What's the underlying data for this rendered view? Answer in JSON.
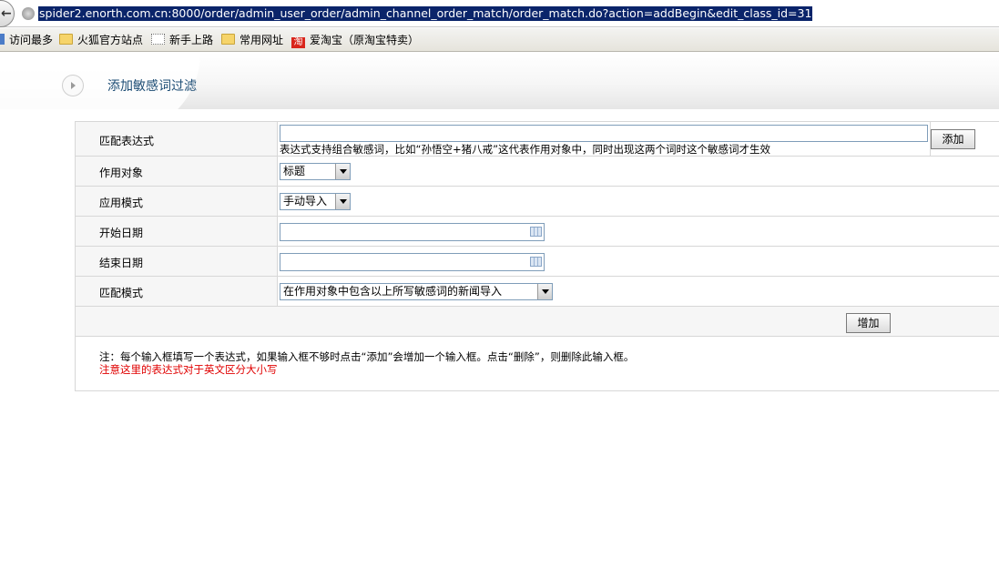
{
  "browser": {
    "url": "spider2.enorth.com.cn:8000/order/admin_user_order/admin_channel_order_match/order_match.do?action=addBegin&edit_class_id=31",
    "bookmarks": [
      {
        "label": "访问最多",
        "icon": "blue-bar-icon"
      },
      {
        "label": "火狐官方站点",
        "icon": "folder-icon"
      },
      {
        "label": "新手上路",
        "icon": "page-icon"
      },
      {
        "label": "常用网址",
        "icon": "folder-icon"
      },
      {
        "label": "爱淘宝（原淘宝特卖）",
        "icon": "taobao-icon",
        "icon_text": "淘"
      }
    ]
  },
  "header": {
    "title": "添加敏感词过滤"
  },
  "form": {
    "expression": {
      "label": "匹配表达式",
      "value": "",
      "hint": "表达式支持组合敏感词，比如“孙悟空+猪八戒”这代表作用对象中，同时出现这两个词时这个敏感词才生效",
      "add_button": "添加"
    },
    "target": {
      "label": "作用对象",
      "selected": "标题"
    },
    "mode": {
      "label": "应用模式",
      "selected": "手动导入"
    },
    "start_date": {
      "label": "开始日期",
      "value": ""
    },
    "end_date": {
      "label": "结束日期",
      "value": ""
    },
    "match_mode": {
      "label": "匹配模式",
      "selected": "在作用对象中包含以上所写敏感词的新闻导入"
    },
    "submit_button": "增加",
    "note": "注：每个输入框填写一个表达式，如果输入框不够时点击“添加”会增加一个输入框。点击“删除”，则删除此输入框。",
    "warning": "注意这里的表达式对于英文区分大小写",
    "colors": {
      "warning": "#e00000",
      "title": "#1c4c74"
    }
  }
}
